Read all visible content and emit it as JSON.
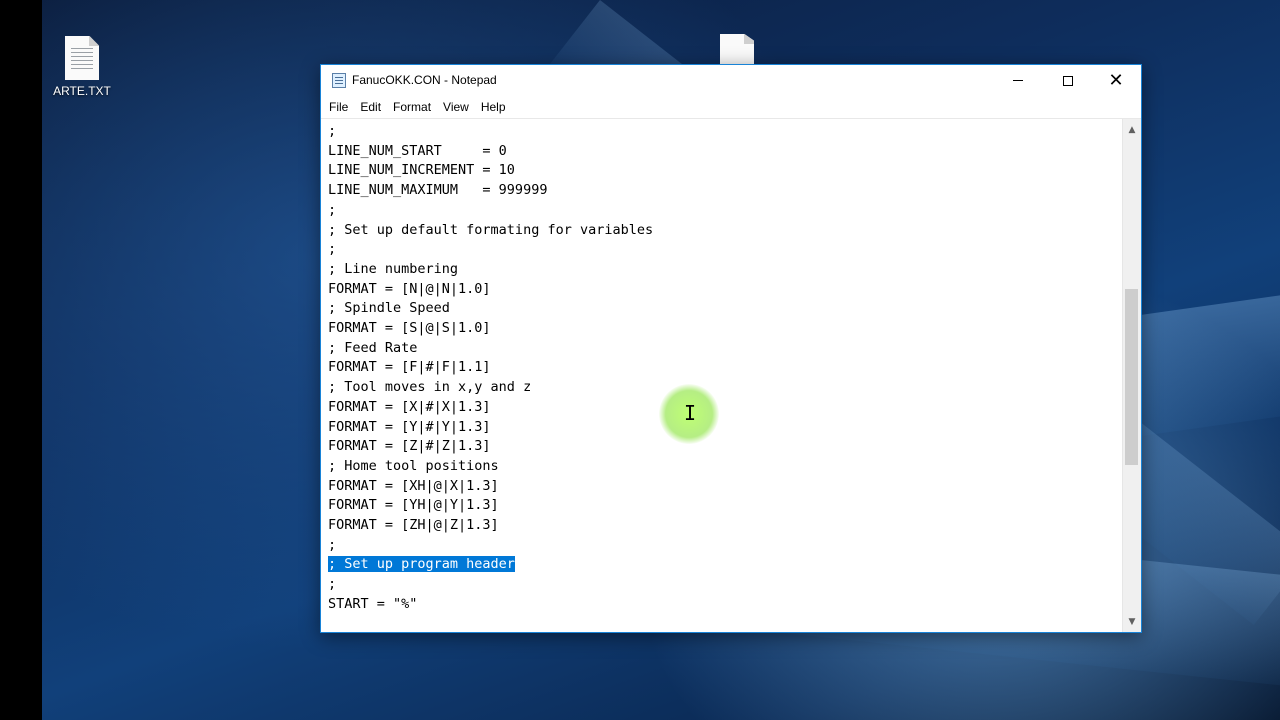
{
  "desktop": {
    "icons": [
      {
        "label": "ARTE.TXT",
        "icon": "text-file-icon"
      },
      {
        "label": "",
        "icon": "text-file-icon"
      }
    ]
  },
  "window": {
    "title": "FanucOKK.CON - Notepad",
    "icon": "notepad-icon",
    "controls": {
      "minimize": "minimize-icon",
      "maximize": "maximize-icon",
      "close": "close-icon"
    }
  },
  "menu": {
    "items": [
      "File",
      "Edit",
      "Format",
      "View",
      "Help"
    ]
  },
  "editor": {
    "lines": [
      ";",
      "LINE_NUM_START     = 0",
      "LINE_NUM_INCREMENT = 10",
      "LINE_NUM_MAXIMUM   = 999999",
      ";",
      "; Set up default formating for variables",
      ";",
      "; Line numbering",
      "FORMAT = [N|@|N|1.0]",
      "; Spindle Speed",
      "FORMAT = [S|@|S|1.0]",
      "; Feed Rate",
      "FORMAT = [F|#|F|1.1]",
      "; Tool moves in x,y and z",
      "FORMAT = [X|#|X|1.3]",
      "FORMAT = [Y|#|Y|1.3]",
      "FORMAT = [Z|#|Z|1.3]",
      "; Home tool positions",
      "FORMAT = [XH|@|X|1.3]",
      "FORMAT = [YH|@|Y|1.3]",
      "FORMAT = [ZH|@|Z|1.3]",
      ";",
      "; Set up program header",
      ";",
      "START = \"%\""
    ],
    "selected_line_index": 22
  },
  "colors": {
    "selection": "#0078d7",
    "window_border": "#1883d7",
    "cursor_highlight": "#a8f060"
  }
}
